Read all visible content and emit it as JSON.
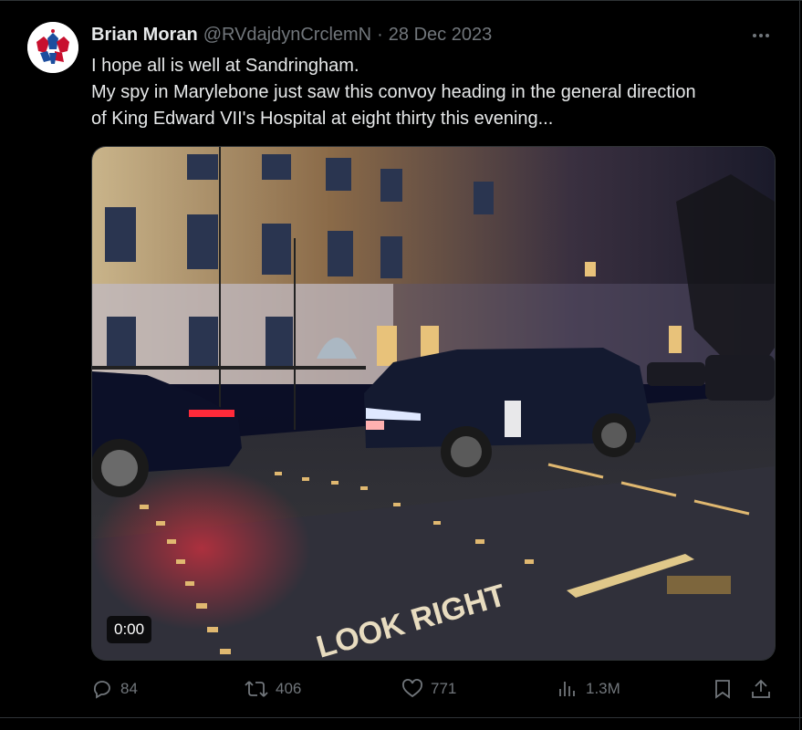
{
  "tweet": {
    "author_name": "Brian Moran",
    "handle": "@RVdajdynCrclemN",
    "separator": "·",
    "date": "28 Dec 2023",
    "text_lines": [
      "I hope all is well at Sandringham.",
      "My spy in Marylebone just saw this convoy heading in the general direction",
      "of King Edward VII's Hospital at eight thirty this evening..."
    ]
  },
  "media": {
    "video_time": "0:00",
    "road_marking": "LOOK RIGHT"
  },
  "actions": {
    "replies": "84",
    "reposts": "406",
    "likes": "771",
    "views": "1.3M"
  },
  "icons": {
    "more": "more-icon",
    "reply": "reply-icon",
    "repost": "repost-icon",
    "like": "heart-icon",
    "views": "views-icon",
    "bookmark": "bookmark-icon",
    "share": "share-icon"
  },
  "colors": {
    "background": "#000000",
    "text": "#e7e9ea",
    "muted": "#71767b",
    "border": "#2f3336"
  }
}
